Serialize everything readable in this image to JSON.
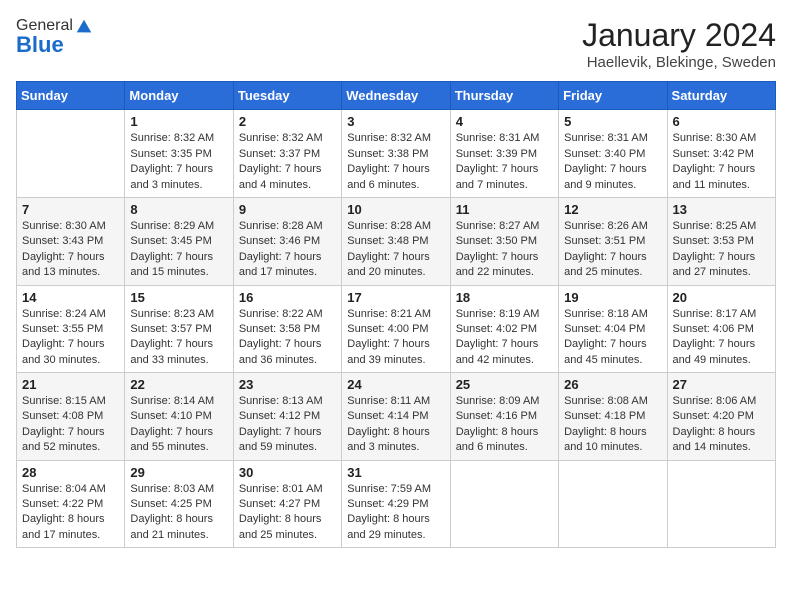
{
  "header": {
    "logo_general": "General",
    "logo_blue": "Blue",
    "month_year": "January 2024",
    "location": "Haellevik, Blekinge, Sweden"
  },
  "weekdays": [
    "Sunday",
    "Monday",
    "Tuesday",
    "Wednesday",
    "Thursday",
    "Friday",
    "Saturday"
  ],
  "weeks": [
    [
      {
        "day": "",
        "info": ""
      },
      {
        "day": "1",
        "info": "Sunrise: 8:32 AM\nSunset: 3:35 PM\nDaylight: 7 hours\nand 3 minutes."
      },
      {
        "day": "2",
        "info": "Sunrise: 8:32 AM\nSunset: 3:37 PM\nDaylight: 7 hours\nand 4 minutes."
      },
      {
        "day": "3",
        "info": "Sunrise: 8:32 AM\nSunset: 3:38 PM\nDaylight: 7 hours\nand 6 minutes."
      },
      {
        "day": "4",
        "info": "Sunrise: 8:31 AM\nSunset: 3:39 PM\nDaylight: 7 hours\nand 7 minutes."
      },
      {
        "day": "5",
        "info": "Sunrise: 8:31 AM\nSunset: 3:40 PM\nDaylight: 7 hours\nand 9 minutes."
      },
      {
        "day": "6",
        "info": "Sunrise: 8:30 AM\nSunset: 3:42 PM\nDaylight: 7 hours\nand 11 minutes."
      }
    ],
    [
      {
        "day": "7",
        "info": "Sunrise: 8:30 AM\nSunset: 3:43 PM\nDaylight: 7 hours\nand 13 minutes."
      },
      {
        "day": "8",
        "info": "Sunrise: 8:29 AM\nSunset: 3:45 PM\nDaylight: 7 hours\nand 15 minutes."
      },
      {
        "day": "9",
        "info": "Sunrise: 8:28 AM\nSunset: 3:46 PM\nDaylight: 7 hours\nand 17 minutes."
      },
      {
        "day": "10",
        "info": "Sunrise: 8:28 AM\nSunset: 3:48 PM\nDaylight: 7 hours\nand 20 minutes."
      },
      {
        "day": "11",
        "info": "Sunrise: 8:27 AM\nSunset: 3:50 PM\nDaylight: 7 hours\nand 22 minutes."
      },
      {
        "day": "12",
        "info": "Sunrise: 8:26 AM\nSunset: 3:51 PM\nDaylight: 7 hours\nand 25 minutes."
      },
      {
        "day": "13",
        "info": "Sunrise: 8:25 AM\nSunset: 3:53 PM\nDaylight: 7 hours\nand 27 minutes."
      }
    ],
    [
      {
        "day": "14",
        "info": "Sunrise: 8:24 AM\nSunset: 3:55 PM\nDaylight: 7 hours\nand 30 minutes."
      },
      {
        "day": "15",
        "info": "Sunrise: 8:23 AM\nSunset: 3:57 PM\nDaylight: 7 hours\nand 33 minutes."
      },
      {
        "day": "16",
        "info": "Sunrise: 8:22 AM\nSunset: 3:58 PM\nDaylight: 7 hours\nand 36 minutes."
      },
      {
        "day": "17",
        "info": "Sunrise: 8:21 AM\nSunset: 4:00 PM\nDaylight: 7 hours\nand 39 minutes."
      },
      {
        "day": "18",
        "info": "Sunrise: 8:19 AM\nSunset: 4:02 PM\nDaylight: 7 hours\nand 42 minutes."
      },
      {
        "day": "19",
        "info": "Sunrise: 8:18 AM\nSunset: 4:04 PM\nDaylight: 7 hours\nand 45 minutes."
      },
      {
        "day": "20",
        "info": "Sunrise: 8:17 AM\nSunset: 4:06 PM\nDaylight: 7 hours\nand 49 minutes."
      }
    ],
    [
      {
        "day": "21",
        "info": "Sunrise: 8:15 AM\nSunset: 4:08 PM\nDaylight: 7 hours\nand 52 minutes."
      },
      {
        "day": "22",
        "info": "Sunrise: 8:14 AM\nSunset: 4:10 PM\nDaylight: 7 hours\nand 55 minutes."
      },
      {
        "day": "23",
        "info": "Sunrise: 8:13 AM\nSunset: 4:12 PM\nDaylight: 7 hours\nand 59 minutes."
      },
      {
        "day": "24",
        "info": "Sunrise: 8:11 AM\nSunset: 4:14 PM\nDaylight: 8 hours\nand 3 minutes."
      },
      {
        "day": "25",
        "info": "Sunrise: 8:09 AM\nSunset: 4:16 PM\nDaylight: 8 hours\nand 6 minutes."
      },
      {
        "day": "26",
        "info": "Sunrise: 8:08 AM\nSunset: 4:18 PM\nDaylight: 8 hours\nand 10 minutes."
      },
      {
        "day": "27",
        "info": "Sunrise: 8:06 AM\nSunset: 4:20 PM\nDaylight: 8 hours\nand 14 minutes."
      }
    ],
    [
      {
        "day": "28",
        "info": "Sunrise: 8:04 AM\nSunset: 4:22 PM\nDaylight: 8 hours\nand 17 minutes."
      },
      {
        "day": "29",
        "info": "Sunrise: 8:03 AM\nSunset: 4:25 PM\nDaylight: 8 hours\nand 21 minutes."
      },
      {
        "day": "30",
        "info": "Sunrise: 8:01 AM\nSunset: 4:27 PM\nDaylight: 8 hours\nand 25 minutes."
      },
      {
        "day": "31",
        "info": "Sunrise: 7:59 AM\nSunset: 4:29 PM\nDaylight: 8 hours\nand 29 minutes."
      },
      {
        "day": "",
        "info": ""
      },
      {
        "day": "",
        "info": ""
      },
      {
        "day": "",
        "info": ""
      }
    ]
  ]
}
